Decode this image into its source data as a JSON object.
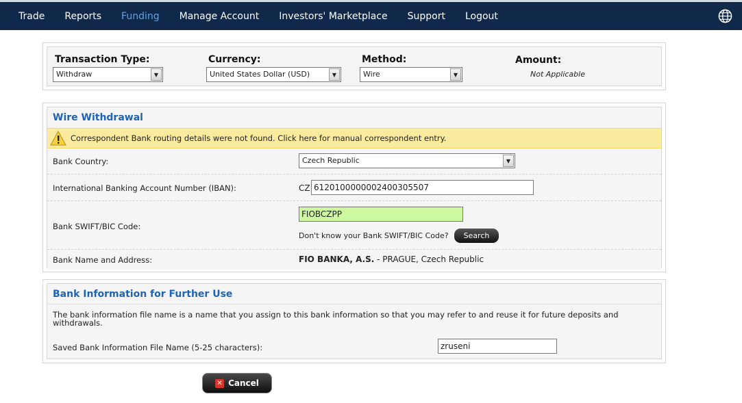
{
  "nav": {
    "items": [
      "Trade",
      "Reports",
      "Funding",
      "Manage Account",
      "Investors' Marketplace",
      "Support",
      "Logout"
    ],
    "active": "Funding"
  },
  "filters": {
    "transaction_type": {
      "label": "Transaction Type:",
      "value": "Withdraw"
    },
    "currency": {
      "label": "Currency:",
      "value": "United States Dollar (USD)"
    },
    "method": {
      "label": "Method:",
      "value": "Wire"
    },
    "amount": {
      "label": "Amount:",
      "value": "Not Applicable"
    }
  },
  "wire": {
    "title": "Wire Withdrawal",
    "warning": "Correspondent Bank routing details were not found. Click here for manual correspondent entry.",
    "country_label": "Bank Country:",
    "country_value": "Czech Republic",
    "iban_label": "International Banking Account Number (IBAN):",
    "iban_prefix": "CZ",
    "iban_value": "6120100000002400305507",
    "swift_label": "Bank SWIFT/BIC Code:",
    "swift_value": "FIOBCZPP",
    "swift_help": "Don't know your Bank SWIFT/BIC Code?",
    "search_label": "Search",
    "bank_label": "Bank Name and Address:",
    "bank_name": "FIO BANKA, A.S.",
    "bank_addr": " - PRAGUE, Czech Republic"
  },
  "further": {
    "title": "Bank Information for Further Use",
    "desc": "The bank information file name is a name that you assign to this bank information so that you may refer to and reuse it for future deposits and withdrawals.",
    "file_label": "Saved Bank Information File Name (5-25 characters):",
    "file_value": "zruseni"
  },
  "cancel_label": "Cancel"
}
